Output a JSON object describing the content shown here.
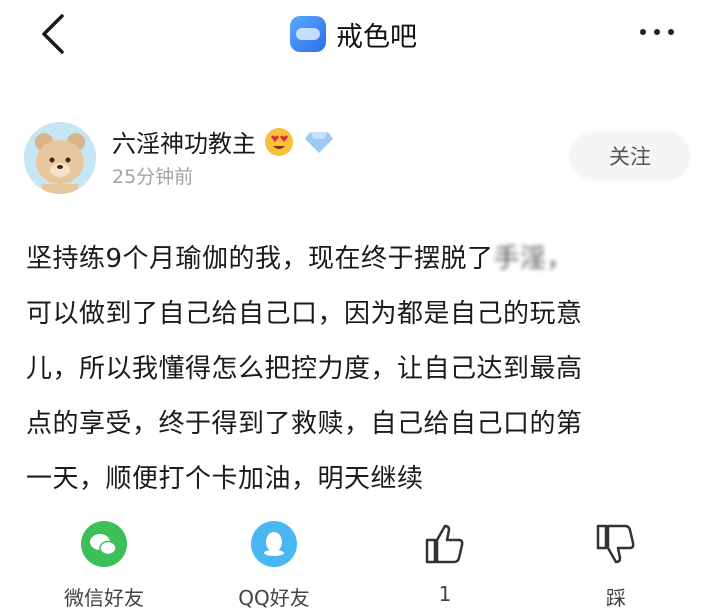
{
  "header": {
    "forum_name": "戒色吧",
    "back_icon": "chevron-left-icon",
    "more_icon": "more-dots-icon"
  },
  "post": {
    "author": "六淫神功教主",
    "time": "25分钟前",
    "follow_label": "关注",
    "lines": [
      "坚持练9个月瑜伽的我，现在终于摆脱了",
      "可以做到了自己给自己口，因为都是自己的玩意",
      "儿，所以我懂得怎么把控力度，让自己达到最高",
      "点的享受，终于得到了救赎，自己给自己口的第",
      "一天，顺便打个卡加油，明天继续"
    ],
    "blurred_tail": "手淫，"
  },
  "actions": {
    "wechat_label": "微信好友",
    "qq_label": "QQ好友",
    "like_count": "1",
    "dislike_label": "踩"
  },
  "colors": {
    "wechat": "#3dbf5a",
    "qq": "#49b7f2",
    "forum_icon": "#3d8af0"
  }
}
